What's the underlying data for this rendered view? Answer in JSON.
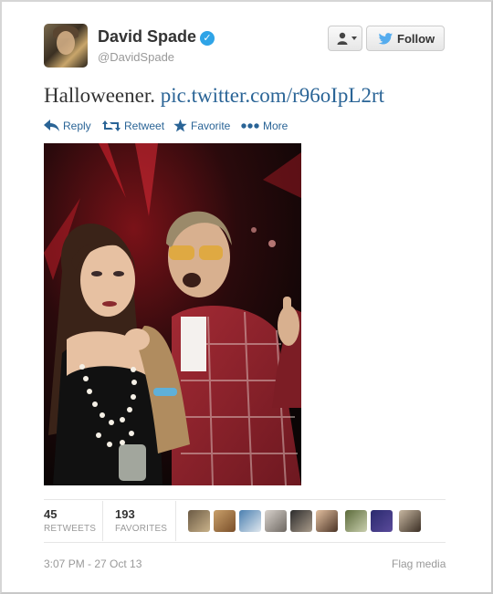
{
  "user": {
    "name": "David Spade",
    "handle": "@DavidSpade"
  },
  "buttons": {
    "follow_label": "Follow"
  },
  "tweet": {
    "text": "Halloweener.",
    "link": "pic.twitter.com/r96oIpL2rt"
  },
  "actions": {
    "reply": "Reply",
    "retweet": "Retweet",
    "favorite": "Favorite",
    "more": "More"
  },
  "stats": {
    "retweets_count": "45",
    "retweets_label": "RETWEETS",
    "favorites_count": "193",
    "favorites_label": "FAVORITES"
  },
  "meta": {
    "timestamp": "3:07 PM - 27 Oct 13",
    "flag": "Flag media"
  },
  "colors": {
    "link": "#2a6496",
    "verified": "#2fa4e7",
    "twitter_bird": "#55acee"
  }
}
